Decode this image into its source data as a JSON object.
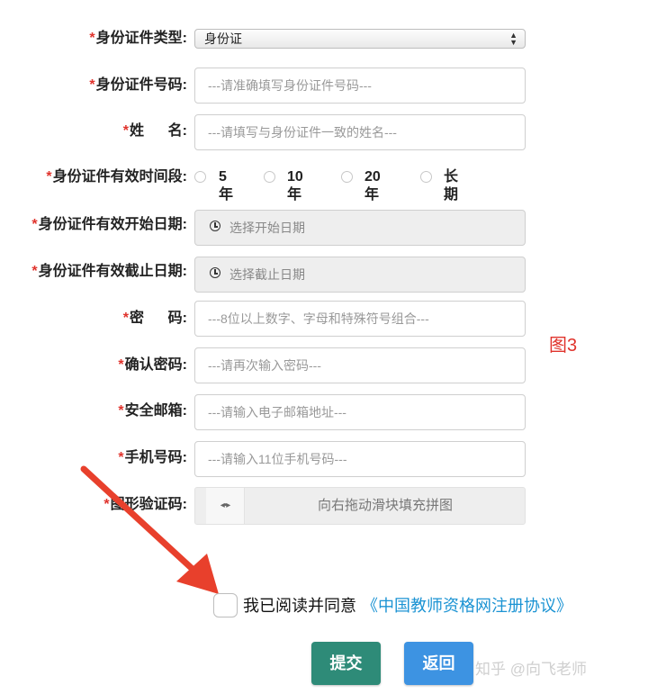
{
  "form": {
    "required_mark": "*",
    "id_type": {
      "label": "身份证件类型:",
      "value": "身份证"
    },
    "id_number": {
      "label": "身份证件号码:",
      "placeholder": "---请准确填写身份证件号码---"
    },
    "name": {
      "label": "姓      名:",
      "placeholder": "---请填写与身份证件一致的姓名---"
    },
    "validity_period": {
      "label": "身份证件有效时间段:",
      "options": [
        "5年",
        "10年",
        "20年",
        "长期"
      ]
    },
    "start_date": {
      "label": "身份证件有效开始日期:",
      "placeholder": "选择开始日期"
    },
    "end_date": {
      "label": "身份证件有效截止日期:",
      "placeholder": "选择截止日期"
    },
    "password": {
      "label": "密      码:",
      "placeholder": "---8位以上数字、字母和特殊符号组合---"
    },
    "confirm_password": {
      "label": "确认密码:",
      "placeholder": "---请再次输入密码---"
    },
    "email": {
      "label": "安全邮箱:",
      "placeholder": "---请输入电子邮箱地址---"
    },
    "phone": {
      "label": "手机号码:",
      "placeholder": "---请输入11位手机号码---"
    },
    "captcha": {
      "label": "图形验证码:",
      "handle": "◂•▸",
      "hint": "向右拖动滑块填充拼图"
    }
  },
  "annotation": {
    "figure_label": "图3",
    "arrow_color": "#e8402c"
  },
  "agreement": {
    "text": "我已阅读并同意",
    "link": "《中国教师资格网注册协议》"
  },
  "buttons": {
    "submit": "提交",
    "back": "返回"
  },
  "watermark": "知乎 @向飞老师",
  "colors": {
    "required": "#e0332c",
    "submit": "#2e8b78",
    "back": "#3d93e2",
    "link": "#1b93d3"
  }
}
